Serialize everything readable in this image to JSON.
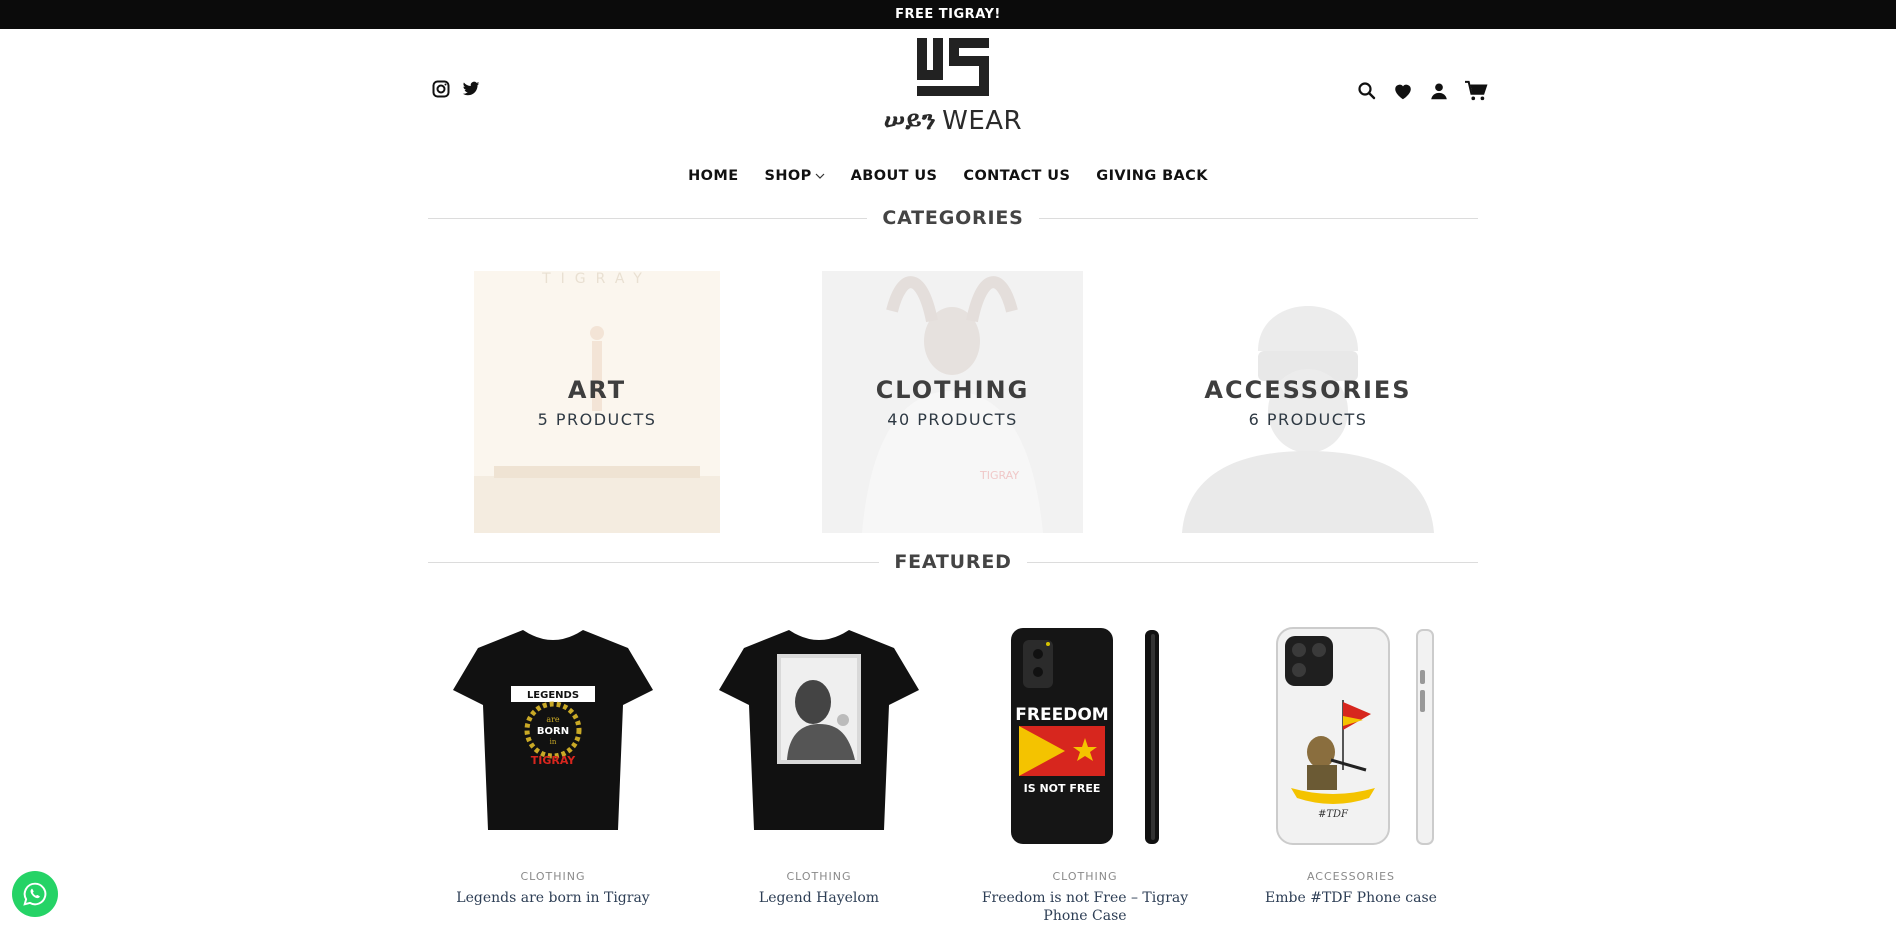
{
  "announcement": "FREE TIGRAY!",
  "logo": {
    "wordmark_ethiopic": "ሠይን",
    "wordmark_latin": "WEAR"
  },
  "social": [
    {
      "icon": "instagram-icon"
    },
    {
      "icon": "twitter-icon"
    }
  ],
  "header_icons": [
    {
      "icon": "search-icon"
    },
    {
      "icon": "heart-icon"
    },
    {
      "icon": "user-icon"
    },
    {
      "icon": "cart-icon"
    }
  ],
  "nav": [
    {
      "label": "HOME"
    },
    {
      "label": "SHOP"
    },
    {
      "label": "ABOUT US"
    },
    {
      "label": "CONTACT US"
    },
    {
      "label": "GIVING BACK"
    }
  ],
  "sections": {
    "categories": "CATEGORIES",
    "featured": "FEATURED"
  },
  "categories": [
    {
      "name": "ART",
      "count": "5 PRODUCTS"
    },
    {
      "name": "CLOTHING",
      "count": "40 PRODUCTS"
    },
    {
      "name": "ACCESSORIES",
      "count": "6 PRODUCTS"
    }
  ],
  "products": [
    {
      "category": "CLOTHING",
      "name": "Legends are born in Tigray",
      "print_top": "LEGENDS",
      "print_mid": "are",
      "print_born": "BORN",
      "print_in": "in",
      "print_bottom": "TIGRAY"
    },
    {
      "category": "CLOTHING",
      "name": "Legend Hayelom"
    },
    {
      "category": "CLOTHING",
      "name_line1": "Freedom is not Free – Tigray",
      "name_line2": "Phone Case",
      "print_top": "FREEDOM",
      "print_bottom": "IS NOT FREE"
    },
    {
      "category": "ACCESSORIES",
      "name": "Embe #TDF Phone case",
      "print_caption": "#TDF"
    }
  ],
  "colors": {
    "whatsapp": "#25d366",
    "tigray_red": "#d7261e",
    "tigray_yellow": "#f4c300"
  }
}
